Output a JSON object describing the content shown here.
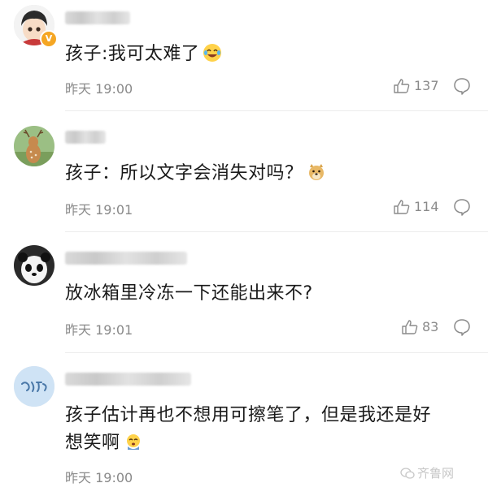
{
  "comments": [
    {
      "text": "孩子:我可太难了",
      "emoji": "laugh-cry-emoji",
      "time": "昨天 19:00",
      "likes": "137",
      "verified": true
    },
    {
      "text": "孩子：所以文字会消失对吗？",
      "emoji": "doge-emoji",
      "time": "昨天 19:01",
      "likes": "114",
      "verified": false
    },
    {
      "text": "放冰箱里冷冻一下还能出来不?",
      "emoji": "",
      "time": "昨天 19:01",
      "likes": "83",
      "verified": false
    },
    {
      "text_line1": "孩子估计再也不想用可擦笔了，但是我还是好",
      "text_line2": "想笑啊",
      "emoji": "crying-emoji",
      "time": "昨天 19:00",
      "likes": "",
      "verified": false
    }
  ],
  "verified_badge": "V",
  "watermark": "齐鲁网",
  "colors": {
    "text": "#1a1a1a",
    "meta": "#8a8a8a",
    "badge": "#f5a623"
  }
}
